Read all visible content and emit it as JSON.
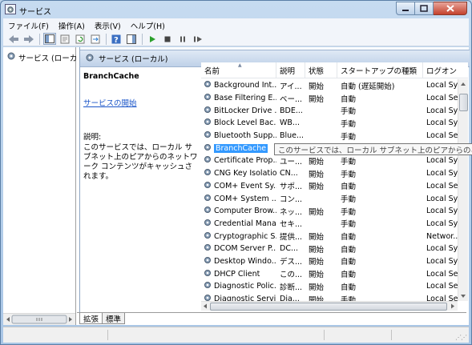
{
  "window": {
    "title": "サービス"
  },
  "menu": [
    "ファイル(F)",
    "操作(A)",
    "表示(V)",
    "ヘルプ(H)"
  ],
  "toolbar": {
    "buttons": [
      "back",
      "forward",
      "show-console-tree",
      "properties",
      "refresh",
      "export-list",
      "help",
      "action-pane",
      "start-service",
      "stop-service",
      "pause-service",
      "restart-service"
    ]
  },
  "tree": {
    "root_label": "サービス (ローカ"
  },
  "content_header": {
    "title": "サービス (ローカル)"
  },
  "details": {
    "service_name": "BranchCache",
    "start_link": "サービスの開始",
    "desc_label": "説明:",
    "desc_text": "このサービスでは、ローカル サブネット上のピアからのネットワーク コンテンツがキャッシュされます。"
  },
  "columns": [
    "名前",
    "説明",
    "状態",
    "スタートアップの種類",
    "ログオン"
  ],
  "services": [
    {
      "name": "Background Int...",
      "desc": "アイ...",
      "status": "開始",
      "startup": "自動 (遅延開始)",
      "logon": "Local Sy..."
    },
    {
      "name": "Base Filtering E...",
      "desc": "ベー...",
      "status": "開始",
      "startup": "自動",
      "logon": "Local Se..."
    },
    {
      "name": "BitLocker Drive ...",
      "desc": "BDE...",
      "status": "",
      "startup": "手動",
      "logon": "Local Sy..."
    },
    {
      "name": "Block Level Bac...",
      "desc": "WB...",
      "status": "",
      "startup": "手動",
      "logon": "Local Sy..."
    },
    {
      "name": "Bluetooth Supp...",
      "desc": "Blue...",
      "status": "",
      "startup": "手動",
      "logon": "Local Se..."
    },
    {
      "name": "BranchCache",
      "desc": "",
      "status": "",
      "startup": "",
      "logon": ""
    },
    {
      "name": "Certificate Prop...",
      "desc": "ユー...",
      "status": "開始",
      "startup": "手動",
      "logon": "Local Sy..."
    },
    {
      "name": "CNG Key Isolation",
      "desc": "CN...",
      "status": "開始",
      "startup": "手動",
      "logon": "Local Sy..."
    },
    {
      "name": "COM+ Event Sy...",
      "desc": "サポ...",
      "status": "開始",
      "startup": "自動",
      "logon": "Local Se..."
    },
    {
      "name": "COM+ System ...",
      "desc": "コン...",
      "status": "",
      "startup": "手動",
      "logon": "Local Sy..."
    },
    {
      "name": "Computer Brow...",
      "desc": "ネッ...",
      "status": "開始",
      "startup": "手動",
      "logon": "Local Sy..."
    },
    {
      "name": "Credential Mana...",
      "desc": "セキ...",
      "status": "",
      "startup": "手動",
      "logon": "Local Sy..."
    },
    {
      "name": "Cryptographic S...",
      "desc": "提供...",
      "status": "開始",
      "startup": "自動",
      "logon": "Networ..."
    },
    {
      "name": "DCOM Server P...",
      "desc": "DC...",
      "status": "開始",
      "startup": "自動",
      "logon": "Local Sy..."
    },
    {
      "name": "Desktop Windo...",
      "desc": "デス...",
      "status": "開始",
      "startup": "自動",
      "logon": "Local Sy..."
    },
    {
      "name": "DHCP Client",
      "desc": "この...",
      "status": "開始",
      "startup": "自動",
      "logon": "Local Se..."
    },
    {
      "name": "Diagnostic Polic...",
      "desc": "診断...",
      "status": "開始",
      "startup": "自動",
      "logon": "Local Se..."
    },
    {
      "name": "Diagnostic Servi...",
      "desc": "Dia...",
      "status": "開始",
      "startup": "手動",
      "logon": "Local Se..."
    }
  ],
  "tooltip": "このサービスでは、ローカル サブネット上のピアからのネット",
  "tabs": [
    "拡張",
    "標準"
  ],
  "colors": {
    "selection": "#3399ff",
    "link": "#1a55c8",
    "header": "#bfd1e8"
  }
}
